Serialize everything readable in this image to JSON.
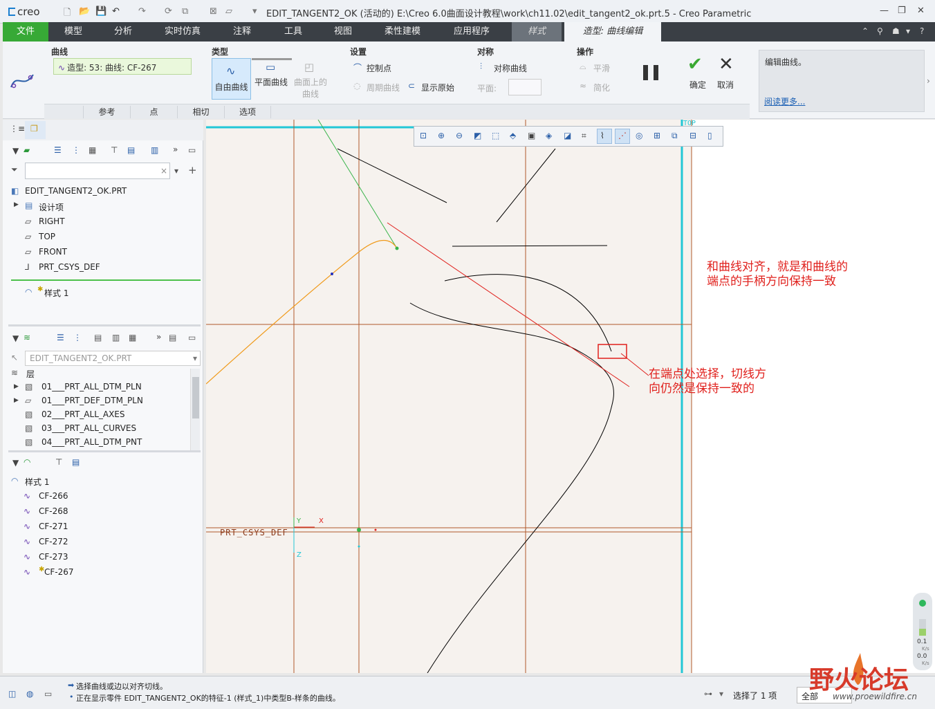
{
  "app": {
    "logo": "creo",
    "window_title": "EDIT_TANGENT2_OK (活动的) E:\\Creo 6.0曲面设计教程\\work\\ch11.02\\edit_tangent2_ok.prt.5 - Creo Parametric",
    "window_buttons": [
      "—",
      "❐",
      "✕"
    ]
  },
  "menu": {
    "items": [
      "文件",
      "模型",
      "分析",
      "实时仿真",
      "注释",
      "工具",
      "视图",
      "柔性建模",
      "应用程序"
    ],
    "style_tab": "样式",
    "active_tab": "造型: 曲线编辑",
    "right_icons": [
      "⌃",
      "⚲",
      "☗",
      "▾",
      "?"
    ]
  },
  "ribbon": {
    "curve_group": "曲线",
    "curve_value": "造型: 53: 曲线: CF-267",
    "type_group": "类型",
    "type_free": "自由曲线",
    "type_plane": "平面曲线",
    "type_surface_line1": "曲面上的",
    "type_surface_line2": "曲线",
    "settings_group": "设置",
    "control_point": "控制点",
    "periodic_curve": "周期曲线",
    "show_original": "显示原始",
    "symmetry_group": "对称",
    "symmetric_curve": "对称曲线",
    "plane_label": "平面:",
    "operations_group": "操作",
    "smooth": "平滑",
    "simplify": "简化",
    "ok": "确定",
    "cancel": "取消",
    "hint_text": "编辑曲线。",
    "read_more": "阅读更多...",
    "subtabs": [
      "参考",
      "点",
      "相切",
      "选项"
    ]
  },
  "model_tree": {
    "filter_placeholder": "",
    "root": "EDIT_TANGENT2_OK.PRT",
    "items": [
      "设计项",
      "RIGHT",
      "TOP",
      "FRONT",
      "PRT_CSYS_DEF"
    ],
    "style_item": "样式 1",
    "style_mark": "✱"
  },
  "layer_tree": {
    "model_select": "EDIT_TANGENT2_OK.PRT",
    "header": "层",
    "items": [
      "01___PRT_ALL_DTM_PLN",
      "01___PRT_DEF_DTM_PLN",
      "02___PRT_ALL_AXES",
      "03___PRT_ALL_CURVES",
      "04___PRT_ALL_DTM_PNT"
    ]
  },
  "style_tree": {
    "root": "样式 1",
    "curves": [
      "CF-266",
      "CF-268",
      "CF-271",
      "CF-272",
      "CF-273",
      "CF-267"
    ]
  },
  "viewport": {
    "top_label": "TOP",
    "csys_label": "PRT_CSYS_DEF",
    "axis_x": "X",
    "axis_y": "Y",
    "axis_z": "Z",
    "annotation1_line1": "和曲线对齐，就是和曲线的",
    "annotation1_line2": "端点的手柄方向保持一致",
    "annotation2_line1": "在端点处选择，切线方",
    "annotation2_line2": "向仍然是保持一致的",
    "widget_value1": "0.1",
    "widget_unit1": "K/s",
    "widget_value2": "0.0",
    "widget_unit2": "K/s"
  },
  "status": {
    "line1": "选择曲线或边以对齐切线。",
    "line2": "正在显示零件 EDIT_TANGENT2_OK的特征-1 (样式_1)中类型B-样条的曲线。",
    "selected": "选择了 1 项",
    "filter": "全部"
  },
  "watermark": {
    "text": "野火论坛",
    "url": "www.proewildfire.cn"
  },
  "colors": {
    "accent_green": "#37a936",
    "menubar": "#3a3f45",
    "annotation_red": "#e0201c",
    "datum_brown": "#b0582a",
    "cyan": "#22c7d6"
  }
}
